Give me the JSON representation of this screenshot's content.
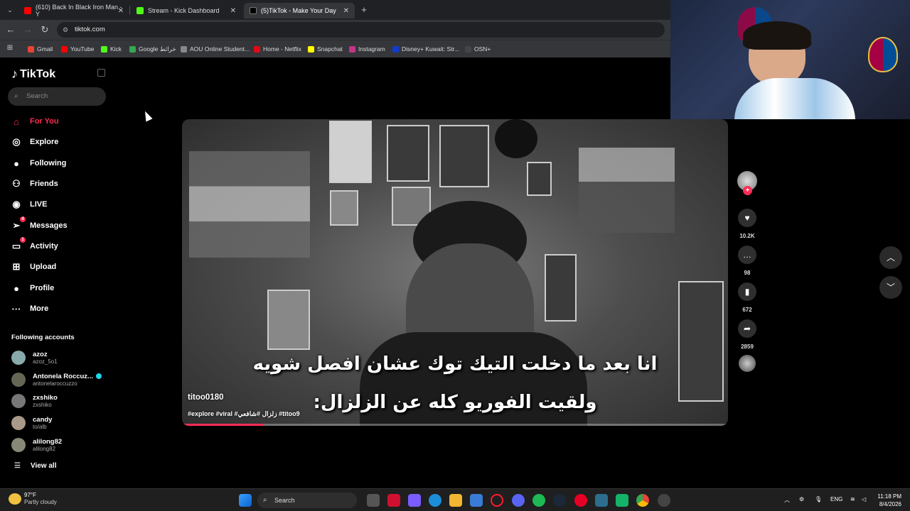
{
  "browser": {
    "tabs": [
      {
        "title": "(610) Back In Black Iron Man - Y",
        "color": "#ff0000"
      },
      {
        "title": "Stream - Kick Dashboard",
        "color": "#53fc18"
      },
      {
        "title": "(5)TikTok - Make Your Day",
        "color": "#000000"
      }
    ],
    "url": "tiktok.com",
    "bookmarks": [
      {
        "label": "Gmail",
        "color": "#ea4335"
      },
      {
        "label": "YouTube",
        "color": "#ff0000"
      },
      {
        "label": "Kick",
        "color": "#53fc18"
      },
      {
        "label": "Google خرائط",
        "color": "#34a853"
      },
      {
        "label": "AOU Online Student...",
        "color": "#888888"
      },
      {
        "label": "Home - Netflix",
        "color": "#e50914"
      },
      {
        "label": "Snapchat",
        "color": "#fffc00"
      },
      {
        "label": "Instagram",
        "color": "#c13584"
      },
      {
        "label": "Disney+ Kuwait: Str...",
        "color": "#113ccf"
      },
      {
        "label": "OSN+",
        "color": "#444444"
      }
    ]
  },
  "sidebar": {
    "logo": "TikTok",
    "search_placeholder": "Search",
    "nav": [
      {
        "label": "For You",
        "icon": "home-icon",
        "glyph": "⌂",
        "active": true,
        "badge": ""
      },
      {
        "label": "Explore",
        "icon": "compass-icon",
        "glyph": "◎",
        "active": false,
        "badge": ""
      },
      {
        "label": "Following",
        "icon": "following-avatar-icon",
        "glyph": "●",
        "active": false,
        "badge": ""
      },
      {
        "label": "Friends",
        "icon": "friends-icon",
        "glyph": "⚇",
        "active": false,
        "badge": ""
      },
      {
        "label": "LIVE",
        "icon": "live-icon",
        "glyph": "◉",
        "active": false,
        "badge": ""
      },
      {
        "label": "Messages",
        "icon": "paper-plane-icon",
        "glyph": "➢",
        "active": false,
        "badge": "4"
      },
      {
        "label": "Activity",
        "icon": "activity-icon",
        "glyph": "▭",
        "active": false,
        "badge": "1"
      },
      {
        "label": "Upload",
        "icon": "upload-icon",
        "glyph": "⊞",
        "active": false,
        "badge": ""
      },
      {
        "label": "Profile",
        "icon": "profile-icon",
        "glyph": "●",
        "active": false,
        "badge": ""
      },
      {
        "label": "More",
        "icon": "more-icon",
        "glyph": "···",
        "active": false,
        "badge": ""
      }
    ],
    "following_title": "Following accounts",
    "accounts": [
      {
        "name": "azoz",
        "username": "azoz_5o1",
        "verified": false
      },
      {
        "name": "Antonela Roccuz...",
        "username": "antonelaroccuzzo",
        "verified": true
      },
      {
        "name": "zxshiko",
        "username": "zxshiko",
        "verified": false
      },
      {
        "name": "candy",
        "username": "to/alb",
        "verified": false
      },
      {
        "name": "alilong82",
        "username": "alilong82",
        "verified": false
      }
    ],
    "view_all": "View all"
  },
  "video": {
    "caption_line1": "انا بعد ما دخلت التيك توك عشان افصل شويه",
    "caption_line2": "ولقيت الفوريو كله عن الزلزال:",
    "author": "titoo0180",
    "hashtags": "#explore #viral #زلزال #شافعي #titoo9",
    "progress": 0.15,
    "likes": "10.2K",
    "comments": "98",
    "saves": "672",
    "shares": "2859"
  },
  "taskbar": {
    "temperature": "97°F",
    "weather": "Partly cloudy",
    "search": "Search",
    "language": "ENG",
    "time": "11:18 PM",
    "date": "8/4/2026"
  }
}
